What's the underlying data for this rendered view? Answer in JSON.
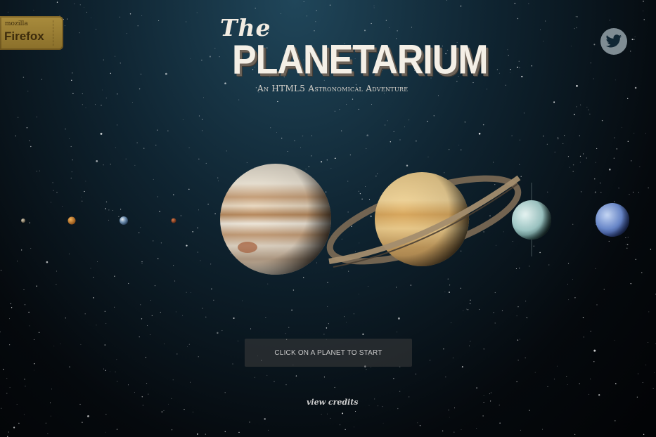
{
  "badge": {
    "small": "mozilla",
    "big": "Firefox"
  },
  "header": {
    "the": "The",
    "title": "PLANETARIUM",
    "subtitle": "An HTML5 Astronomical Adventure"
  },
  "planets": [
    "Mercury",
    "Venus",
    "Earth",
    "Mars",
    "Jupiter",
    "Saturn",
    "Uranus",
    "Neptune"
  ],
  "cta": {
    "start": "Click on a planet to start"
  },
  "footer": {
    "credits": "view credits"
  },
  "icons": {
    "share": "twitter-bird-icon",
    "badge": "firefox-badge-icon"
  }
}
